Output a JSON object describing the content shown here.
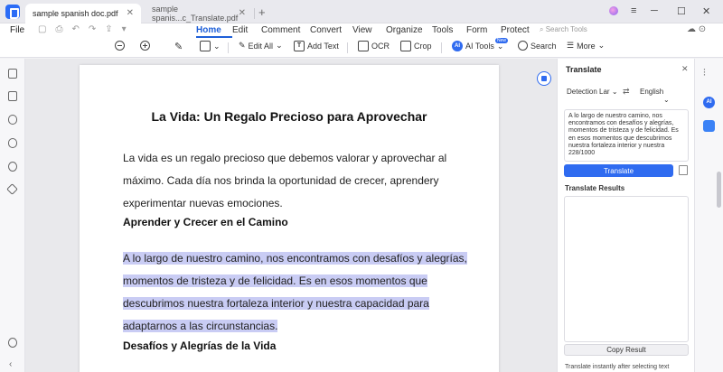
{
  "tabs": [
    {
      "label": "sample spanish doc.pdf",
      "active": true
    },
    {
      "label": "sample spanis...c_Translate.pdf",
      "active": false
    }
  ],
  "menu": {
    "file": "File",
    "items": [
      "Home",
      "Edit",
      "Comment",
      "Convert",
      "View",
      "Organize",
      "Tools",
      "Form",
      "Protect"
    ],
    "active": "Home",
    "search_tools": "Search Tools"
  },
  "toolbar": {
    "edit_all": "Edit All",
    "add_text": "Add Text",
    "ocr": "OCR",
    "crop": "Crop",
    "ai_tools": "AI Tools",
    "new_badge": "New",
    "search": "Search",
    "more": "More"
  },
  "document": {
    "title": "La Vida: Un Regalo Precioso para Aprovechar",
    "para1": [
      "La vida es un regalo precioso que debemos valorar y aprovechar al",
      "máximo. Cada día nos brinda la oportunidad de crecer, aprendery",
      "experimentar nuevas emociones."
    ],
    "heading1": "Aprender y Crecer en el Camino",
    "para2": [
      "A lo largo de nuestro camino, nos encontramos con desafíos y alegrías,",
      "momentos de tristeza y de felicidad. Es en esos momentos que",
      "descubrimos nuestra fortaleza interior y nuestra capacidad para",
      "adaptarnos a las circunstancias."
    ],
    "heading2": "Desafíos y Alegrías de la Vida"
  },
  "translate": {
    "title": "Translate",
    "source_lang": "Detection Lar",
    "target_lang": "English",
    "source_text": "A lo largo de nuestro camino, nos encontramos con desafíos y alegrías, momentos de tristeza y de felicidad. Es en esos momentos que descubrimos nuestra fortaleza interior y nuestra",
    "counter": "228/1000",
    "translate_button": "Translate",
    "results_label": "Translate Results",
    "copy_button": "Copy Result",
    "hint": "Translate instantly after selecting text"
  },
  "colors": {
    "accent": "#2f6bf0",
    "highlight": "#c9ccf4"
  }
}
